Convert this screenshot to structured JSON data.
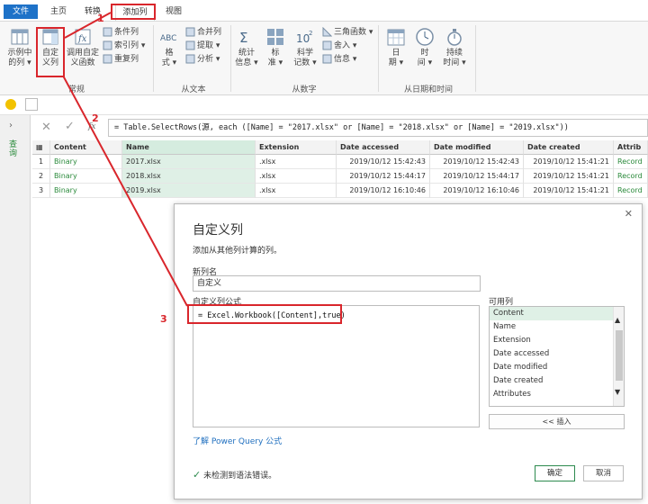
{
  "menu": {
    "tabs": [
      "文件",
      "主页",
      "转换",
      "添加列",
      "视图"
    ]
  },
  "ribbon": {
    "buttons": {
      "example": [
        "示例中",
        "的列 ▾"
      ],
      "custom": [
        "自定",
        "义列"
      ],
      "invoke": [
        "调用自定",
        "义函数"
      ],
      "conditional": "条件列",
      "index": "索引列 ▾",
      "duplicate": "重复列",
      "format": [
        "格",
        "式 ▾"
      ],
      "merge": "合并列",
      "extract": "提取 ▾",
      "analyze": "分析 ▾",
      "stats": [
        "统计",
        "信息 ▾"
      ],
      "standard": [
        "标",
        "准 ▾"
      ],
      "scientific": [
        "科学",
        "记数 ▾"
      ],
      "trig": "三角函数 ▾",
      "round": "舍入 ▾",
      "info": "信息 ▾",
      "date": [
        "日",
        "期 ▾"
      ],
      "time": [
        "时",
        "间 ▾"
      ],
      "duration": [
        "持续",
        "时间 ▾"
      ]
    },
    "groups": [
      "常规",
      "从文本",
      "从数字",
      "从日期和时间"
    ]
  },
  "formula_bar": {
    "fx": "fx",
    "formula": "= Table.SelectRows(源, each ([Name] = \"2017.xlsx\" or [Name] = \"2018.xlsx\" or [Name] = \"2019.xlsx\"))"
  },
  "left_nav": {
    "label": "查询"
  },
  "table": {
    "columns": [
      "Content",
      "Name",
      "Extension",
      "Date accessed",
      "Date modified",
      "Date created",
      "Attrib"
    ],
    "rows": [
      {
        "n": "1",
        "content": "Binary",
        "name": "2017.xlsx",
        "ext": ".xlsx",
        "accessed": "2019/10/12 15:42:43",
        "modified": "2019/10/12 15:42:43",
        "created": "2019/10/12 15:41:21",
        "attr": "Record"
      },
      {
        "n": "2",
        "content": "Binary",
        "name": "2018.xlsx",
        "ext": ".xlsx",
        "accessed": "2019/10/12 15:44:17",
        "modified": "2019/10/12 15:44:17",
        "created": "2019/10/12 15:41:21",
        "attr": "Record"
      },
      {
        "n": "3",
        "content": "Binary",
        "name": "2019.xlsx",
        "ext": ".xlsx",
        "accessed": "2019/10/12 16:10:46",
        "modified": "2019/10/12 16:10:46",
        "created": "2019/10/12 15:41:21",
        "attr": "Record"
      }
    ]
  },
  "dialog": {
    "title": "自定义列",
    "subtitle": "添加从其他列计算的列。",
    "new_col_label": "新列名",
    "new_col_value": "自定义",
    "formula_label": "自定义列公式",
    "formula": "= Excel.Workbook([Content],true)",
    "available_label": "可用列",
    "available": [
      "Content",
      "Name",
      "Extension",
      "Date accessed",
      "Date modified",
      "Date created",
      "Attributes"
    ],
    "insert": "<< 插入",
    "learn": "了解 Power Query 公式",
    "status": "未检测到语法错误。",
    "ok": "确定",
    "cancel": "取消",
    "close": "✕"
  },
  "annotations": [
    "1",
    "2",
    "3"
  ],
  "colors": {
    "accent": "#1e72c8",
    "annotation": "#d9262c",
    "selection": "#dff0e6",
    "ok": "#2d8a4e"
  }
}
